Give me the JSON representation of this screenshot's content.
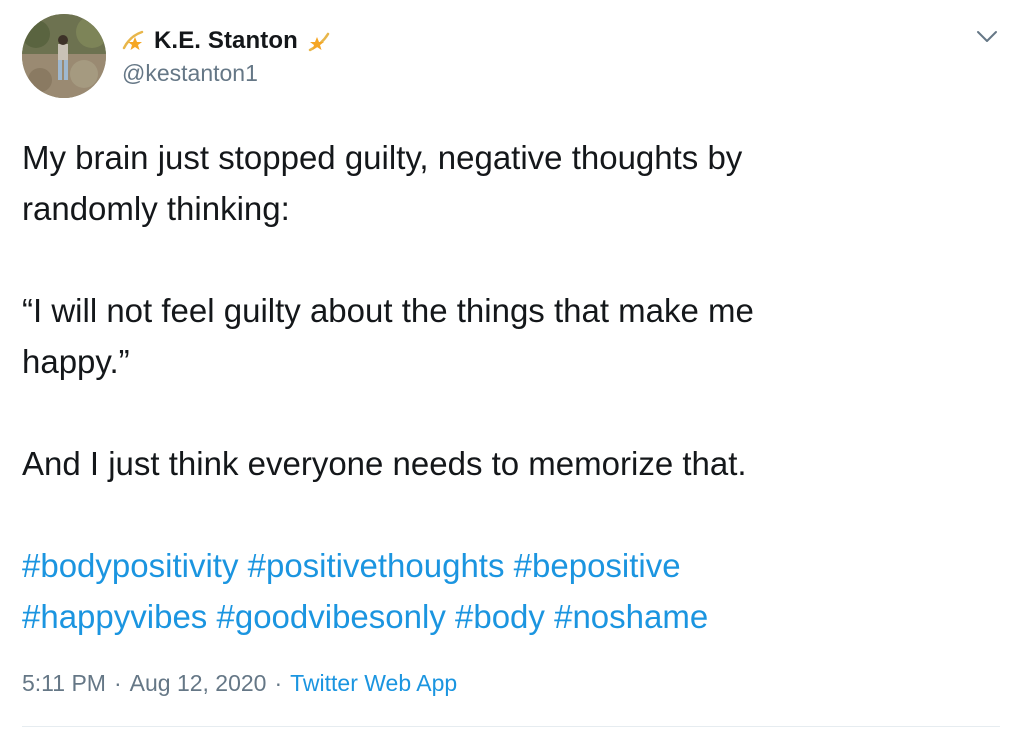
{
  "author": {
    "display_name": "K.E. Stanton",
    "handle": "@kestanton1",
    "name_emoji_left": "shooting-star-icon",
    "name_emoji_right": "shooting-star-icon"
  },
  "tweet": {
    "line1": "My brain just stopped guilty, negative thoughts by",
    "line2": "randomly thinking:",
    "line3": "“I will not feel guilty about the things that make me",
    "line4": "happy.”",
    "line5": "And I just think everyone needs to memorize that.",
    "hashtags_row1": [
      "#bodypositivity",
      "#positivethoughts",
      "#bepositive"
    ],
    "hashtags_row2": [
      "#happyvibes",
      "#goodvibesonly",
      "#body",
      "#noshame"
    ]
  },
  "meta": {
    "time": "5:11 PM",
    "date": "Aug 12, 2020",
    "separator": "·",
    "source": "Twitter Web App"
  },
  "icons": {
    "more": "chevron-down-icon"
  },
  "colors": {
    "text": "#14171a",
    "secondary": "#657786",
    "link": "#1b95e0",
    "divider": "#e6ecf0"
  }
}
